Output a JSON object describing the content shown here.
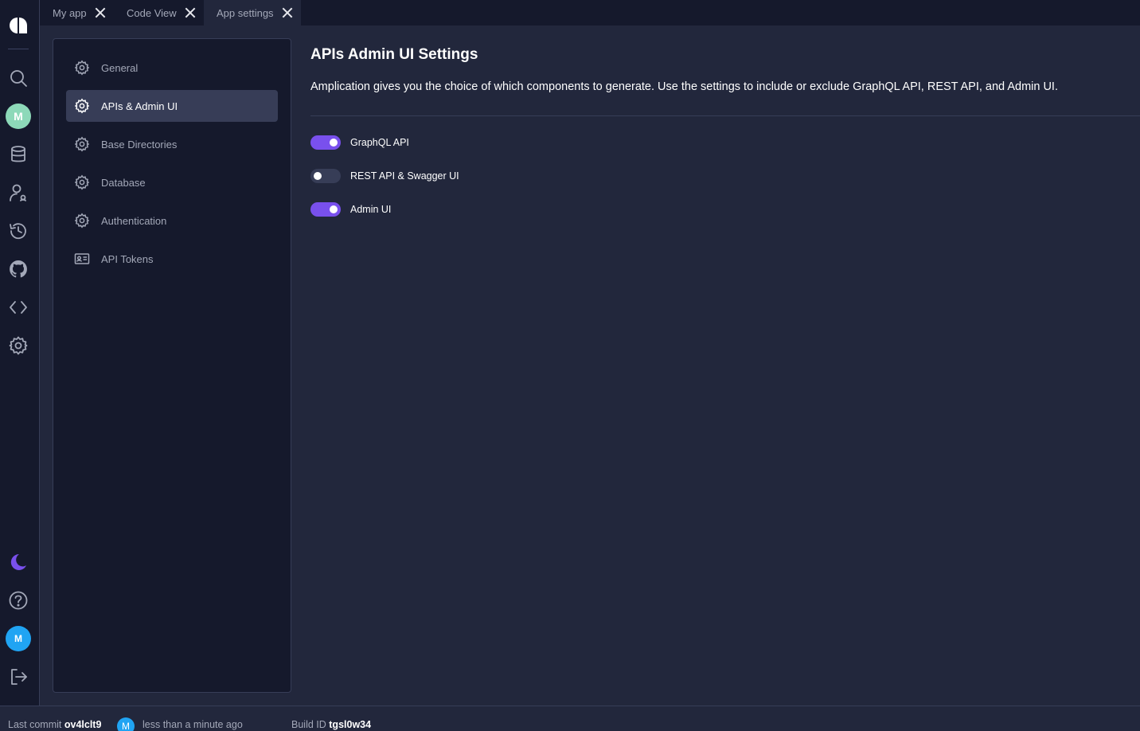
{
  "tabs": [
    {
      "label": "My app"
    },
    {
      "label": "Code View"
    },
    {
      "label": "App settings"
    }
  ],
  "rail": {
    "top_avatar_initial": "M",
    "bottom_avatar_initial": "M",
    "icons": [
      "logo-icon",
      "search-icon",
      "database-icon",
      "users-icon",
      "history-icon",
      "github-icon",
      "code-icon",
      "gear-icon",
      "moon-icon",
      "help-icon",
      "logout-icon"
    ]
  },
  "settings_nav": {
    "items": [
      {
        "label": "General",
        "icon": "gear-icon"
      },
      {
        "label": "APIs & Admin UI",
        "icon": "gear-icon"
      },
      {
        "label": "Base Directories",
        "icon": "gear-icon"
      },
      {
        "label": "Database",
        "icon": "gear-icon"
      },
      {
        "label": "Authentication",
        "icon": "gear-icon"
      },
      {
        "label": "API Tokens",
        "icon": "id-card-icon"
      }
    ],
    "active": "APIs & Admin UI"
  },
  "main": {
    "title": "APIs Admin UI Settings",
    "description": "Amplication gives you the choice of which components to generate. Use the settings to include or exclude GraphQL API, REST API, and Admin UI.",
    "toggles": [
      {
        "label": "GraphQL API",
        "on": true
      },
      {
        "label": "REST API & Swagger UI",
        "on": false
      },
      {
        "label": "Admin UI",
        "on": true
      }
    ]
  },
  "footer": {
    "last_commit_label": "Last commit",
    "commit_id": "ov4lclt9",
    "commit_avatar_initial": "M",
    "commit_time": "less than a minute ago",
    "build_label": "Build ID",
    "build_id": "tgsl0w34"
  },
  "colors": {
    "accent": "#7950ed",
    "rail_bg": "#15192c",
    "content_bg": "#22273c",
    "avatar_top": "#8dd9b9",
    "avatar_bottom": "#20a4f3",
    "moon": "#7950ed"
  }
}
